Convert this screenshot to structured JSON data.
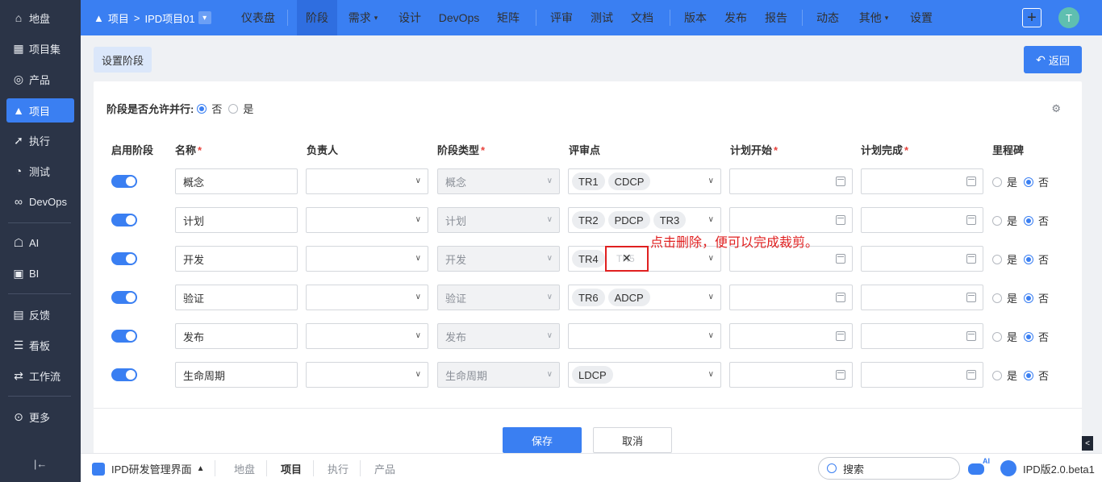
{
  "sidebar": {
    "items": [
      {
        "label": "地盘",
        "icon": "home-icon"
      },
      {
        "label": "项目集",
        "icon": "grid-icon"
      },
      {
        "label": "产品",
        "icon": "lightbulb-icon"
      },
      {
        "label": "项目",
        "icon": "project-icon",
        "active": true
      },
      {
        "label": "执行",
        "icon": "rocket-icon"
      },
      {
        "label": "测试",
        "icon": "test-icon"
      },
      {
        "label": "DevOps",
        "icon": "infinity-icon"
      },
      {
        "label": "AI",
        "icon": "robot-icon"
      },
      {
        "label": "BI",
        "icon": "chart-icon"
      },
      {
        "label": "反馈",
        "icon": "feedback-icon"
      },
      {
        "label": "看板",
        "icon": "kanban-icon"
      },
      {
        "label": "工作流",
        "icon": "workflow-icon"
      },
      {
        "label": "更多",
        "icon": "more-icon"
      }
    ],
    "collapse_glyph": "|←"
  },
  "topbar": {
    "breadcrumb_root": "项目",
    "breadcrumb_sep": ">",
    "breadcrumb_project": "IPD项目01",
    "nav": [
      "仪表盘",
      "阶段",
      "需求",
      "设计",
      "DevOps",
      "矩阵",
      "评审",
      "测试",
      "文档",
      "版本",
      "发布",
      "报告",
      "动态",
      "其他",
      "设置"
    ],
    "active_nav": "阶段",
    "avatar": "T"
  },
  "subheader": {
    "tab": "设置阶段",
    "back": "返回"
  },
  "form": {
    "parallel_label": "阶段是否允许并行:",
    "no": "否",
    "yes": "是",
    "headers": {
      "enable": "启用阶段",
      "name": "名称",
      "owner": "负责人",
      "type": "阶段类型",
      "review": "评审点",
      "plan_start": "计划开始",
      "plan_end": "计划完成",
      "milestone": "里程碑"
    },
    "required_mark": "*",
    "rows": [
      {
        "name": "概念",
        "type": "概念",
        "tags": [
          "TR1",
          "CDCP"
        ]
      },
      {
        "name": "计划",
        "type": "计划",
        "tags": [
          "TR2",
          "PDCP",
          "TR3"
        ]
      },
      {
        "name": "开发",
        "type": "开发",
        "tags": [
          "TR4"
        ]
      },
      {
        "name": "验证",
        "type": "验证",
        "tags": [
          "TR6",
          "ADCP"
        ]
      },
      {
        "name": "发布",
        "type": "发布",
        "tags": []
      },
      {
        "name": "生命周期",
        "type": "生命周期",
        "tags": [
          "LDCP"
        ]
      }
    ],
    "save": "保存",
    "cancel": "取消"
  },
  "annotation": {
    "text": "点击删除，便可以完成裁剪。",
    "close_glyph": "✕",
    "ghost_tag": "TR5"
  },
  "bottombar": {
    "app": "IPD研发管理界面",
    "items": [
      "地盘",
      "项目",
      "执行",
      "产品"
    ],
    "active": "项目",
    "search": "搜索",
    "ai": "AI",
    "version": "IPD版2.0.beta1"
  }
}
